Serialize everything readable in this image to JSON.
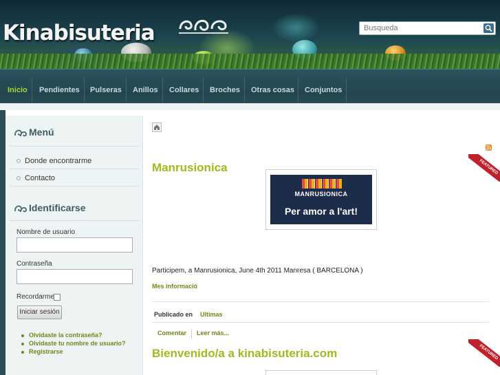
{
  "header": {
    "logo_text": "Kinabisuteria",
    "search_placeholder": "Busqueda"
  },
  "nav": {
    "items": [
      {
        "label": "Inicio",
        "active": true
      },
      {
        "label": "Pendientes"
      },
      {
        "label": "Pulseras"
      },
      {
        "label": "Anillos"
      },
      {
        "label": "Collares"
      },
      {
        "label": "Broches"
      },
      {
        "label": "Otras cosas"
      },
      {
        "label": "Conjuntos"
      }
    ]
  },
  "sidebar": {
    "menu_title": "Menú",
    "menu_items": [
      "Donde encontrarme",
      "Contacto"
    ],
    "login_title": "Identificarse",
    "username_label": "Nombre de usuario",
    "password_label": "Contraseña",
    "remember_label": "Recordarme",
    "login_button": "Iniciar sesión",
    "links": [
      "Olvidaste la contraseña?",
      "Olvidaste tu nombre de usuario?",
      "Registrarse"
    ]
  },
  "main": {
    "featured_badge": "FEATURED",
    "article1": {
      "title": "Manrusionica",
      "banner_line1": "MANRUSIONICA",
      "banner_line2": "Per amor a l'art!",
      "body": "Participem, a Manrusionica, June 4th 2011 Manresa ( BARCELONA )",
      "more_link": "Mes informació",
      "published_label": "Publicado en",
      "category": "Ultimas",
      "comment_link": "Comentar",
      "read_more": "Leer más..."
    },
    "article2": {
      "title": "Bienvenido/a a kinabisuteria.com"
    }
  },
  "colors": {
    "accent_green": "#9dbb1f",
    "nav_active": "#a9d23c",
    "nav_bg": "#23454e",
    "featured_red": "#c0202a"
  }
}
